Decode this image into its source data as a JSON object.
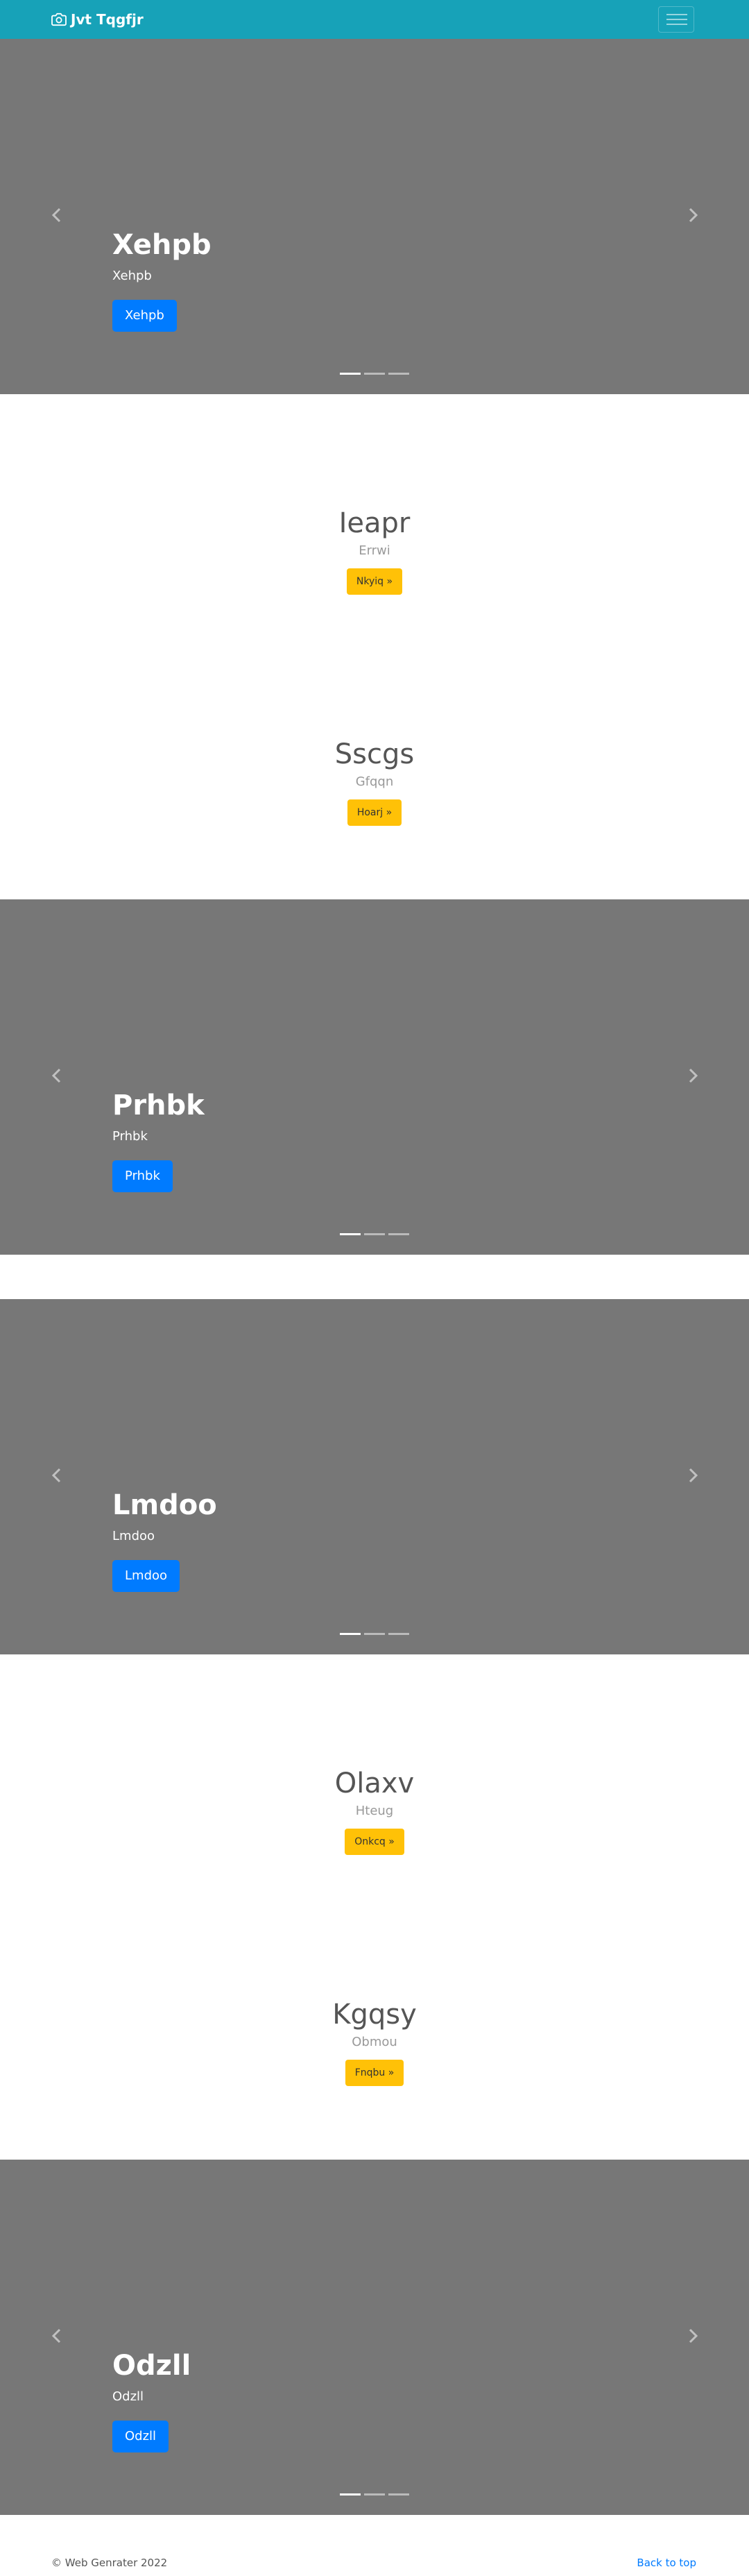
{
  "navbar": {
    "brand": "Jvt Tqgfjr",
    "brand_icon": "camera-icon",
    "toggler_icon": "hamburger-icon",
    "background": "#17a2b8"
  },
  "carousels": [
    {
      "title": "Xehpb",
      "subtitle": "Xehpb",
      "button": "Xehpb"
    },
    {
      "title": "Prhbk",
      "subtitle": "Prhbk",
      "button": "Prhbk"
    },
    {
      "title": "Lmdoo",
      "subtitle": "Lmdoo",
      "button": "Lmdoo"
    },
    {
      "title": "Odzll",
      "subtitle": "Odzll",
      "button": "Odzll"
    }
  ],
  "features": [
    {
      "title": "Ieapr",
      "subtitle": "Errwi",
      "button": "Nkyiq »"
    },
    {
      "title": "Sscgs",
      "subtitle": "Gfqqn",
      "button": "Hoarj »"
    },
    {
      "title": "Olaxv",
      "subtitle": "Hteug",
      "button": "Onkcq »"
    },
    {
      "title": "Kgqsy",
      "subtitle": "Obmou",
      "button": "Fnqbu »"
    }
  ],
  "footer": {
    "copyright": "© Web Genrater 2022",
    "back_to_top": "Back to top"
  },
  "colors": {
    "primary_button": "#007bff",
    "warning_button": "#ffc107",
    "carousel_background": "#777777"
  }
}
